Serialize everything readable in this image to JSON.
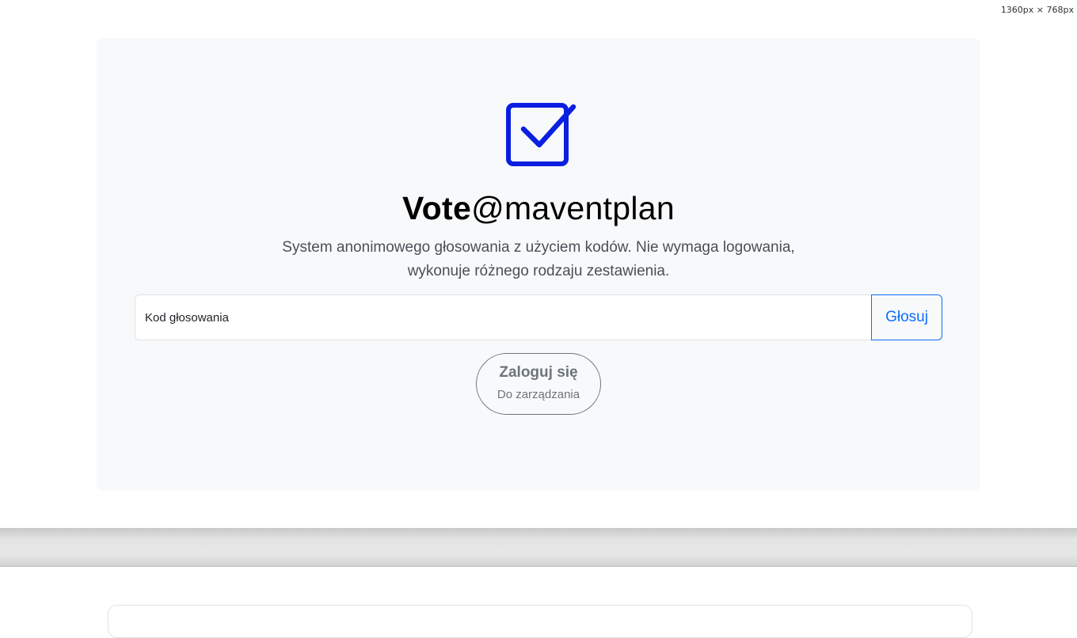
{
  "viewport_badge": "1360px × 768px",
  "hero": {
    "icon": "checkbox-checked-icon",
    "title_strong": "Vote",
    "title_rest": "@maventplan",
    "lead": "System anonimowego głosowania z użyciem kodów. Nie wymaga logowania, wykonuje różnego rodzaju zestawienia.",
    "vote_input_placeholder": "Kod głosowania",
    "vote_button_label": "Głosuj",
    "login_button_label": "Zaloguj się",
    "login_button_sublabel": "Do zarządzania"
  },
  "colors": {
    "accent": "#0d6efd",
    "icon": "#0a1fe0",
    "hero_bg": "#f8f9fa",
    "secondary": "#6c757d"
  }
}
